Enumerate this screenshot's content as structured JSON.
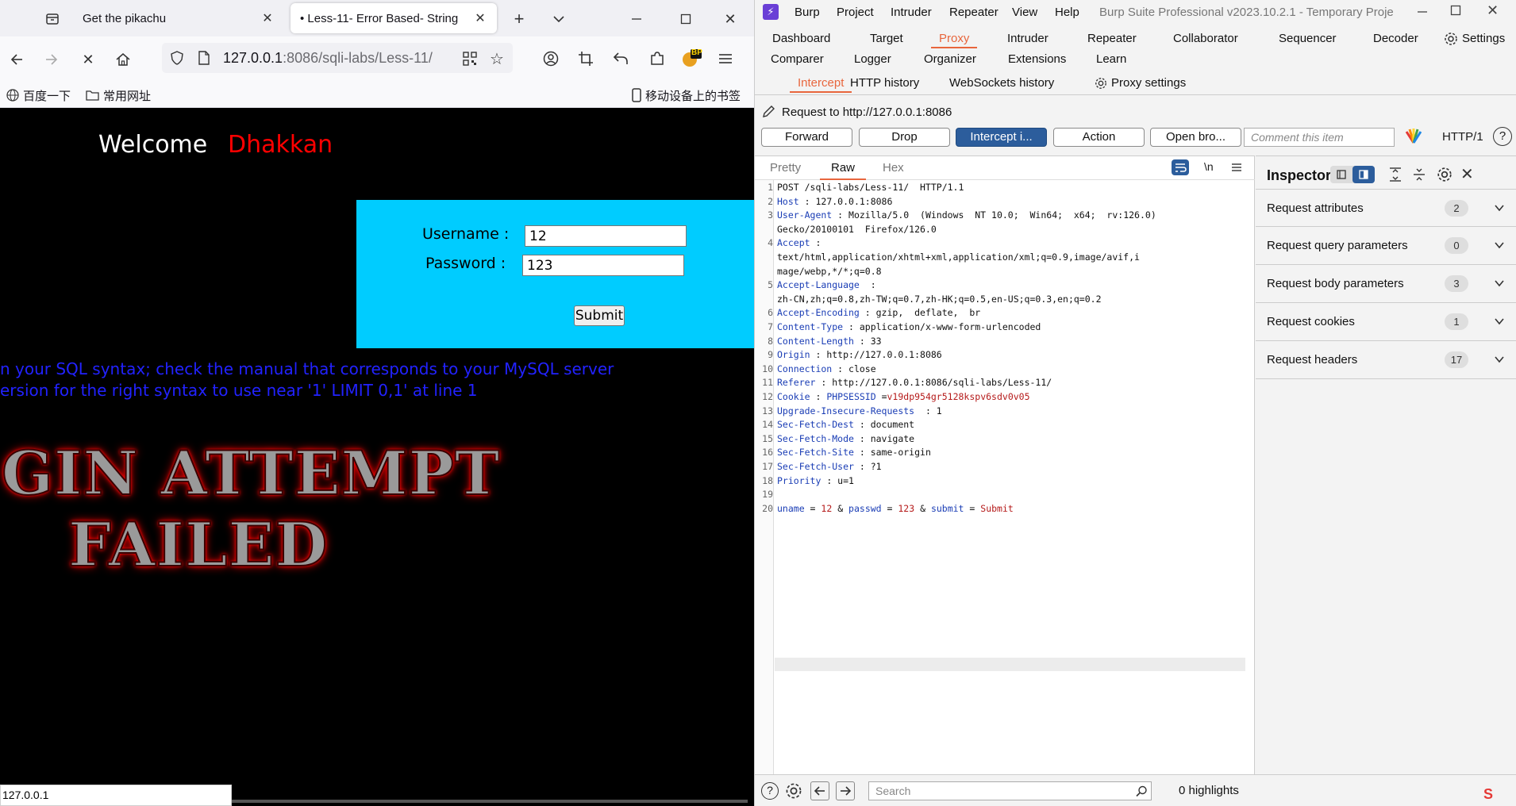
{
  "firefox": {
    "tabs": [
      {
        "title": "Get the pikachu"
      },
      {
        "title": "• Less-11- Error Based- String"
      }
    ],
    "url_host": "127.0.0.1",
    "url_rest": ":8086/sqli-labs/Less-11/",
    "bookmarks": [
      "百度一下",
      "常用网址"
    ],
    "mobile_bookmarks": "移动设备上的书签",
    "status_url": "127.0.0.1",
    "extension_badge": "BP"
  },
  "page": {
    "welcome": "Welcome",
    "name": "Dhakkan",
    "username_label": "Username :",
    "username_value": "12",
    "password_label": "Password :",
    "password_value": "123",
    "submit_label": "Submit",
    "error_line1": "n your SQL syntax; check the manual that corresponds to your MySQL server",
    "error_line2": "ersion for the right syntax to use near '1' LIMIT 0,1' at line 1",
    "fail_line1": "GIN ATTEMPT",
    "fail_line2": "FAILED"
  },
  "burp": {
    "logo": "⚡",
    "menu": [
      "Burp",
      "Project",
      "Intruder",
      "Repeater",
      "View",
      "Help"
    ],
    "window_title": "Burp Suite Professional v2023.10.2.1 - Temporary Proje",
    "tabs_row1": [
      "Dashboard",
      "Target",
      "Proxy",
      "Intruder",
      "Repeater",
      "Collaborator",
      "Sequencer",
      "Decoder"
    ],
    "tabs_row2": [
      "Comparer",
      "Logger",
      "Organizer",
      "Extensions",
      "Learn"
    ],
    "settings": "Settings",
    "proxy_tabs": [
      "Intercept",
      "HTTP history",
      "WebSockets history"
    ],
    "proxy_settings": "Proxy settings",
    "request_to": "Request to http://127.0.0.1:8086",
    "buttons": {
      "forward": "Forward",
      "drop": "Drop",
      "intercept": "Intercept i...",
      "action": "Action",
      "open_browser": "Open bro..."
    },
    "comment_placeholder": "Comment this item",
    "http_version": "HTTP/1",
    "editor_tabs": [
      "Pretty",
      "Raw",
      "Hex"
    ],
    "newline_toggle": "\\n",
    "request": [
      {
        "n": "1",
        "k": "",
        "v": "POST /sqli-labs/Less-11/  HTTP/1.1"
      },
      {
        "n": "2",
        "k": "Host",
        "v": " : 127.0.0.1:8086"
      },
      {
        "n": "3",
        "k": "User-Agent",
        "v": " : Mozilla/5.0  (Windows  NT 10.0;  Win64;  x64;  rv:126.0)"
      },
      {
        "n": "",
        "k": "",
        "v": "Gecko/20100101  Firefox/126.0"
      },
      {
        "n": "4",
        "k": "Accept",
        "v": " :"
      },
      {
        "n": "",
        "k": "",
        "v": "text/html,application/xhtml+xml,application/xml;q=0.9,image/avif,i"
      },
      {
        "n": "",
        "k": "",
        "v": "mage/webp,*/*;q=0.8"
      },
      {
        "n": "5",
        "k": "Accept-Language",
        "v": "  :"
      },
      {
        "n": "",
        "k": "",
        "v": "zh-CN,zh;q=0.8,zh-TW;q=0.7,zh-HK;q=0.5,en-US;q=0.3,en;q=0.2"
      },
      {
        "n": "6",
        "k": "Accept-Encoding",
        "v": " : gzip,  deflate,  br"
      },
      {
        "n": "7",
        "k": "Content-Type",
        "v": " : application/x-www-form-urlencoded"
      },
      {
        "n": "8",
        "k": "Content-Length",
        "v": " : 33"
      },
      {
        "n": "9",
        "k": "Origin",
        "v": " : http://127.0.0.1:8086"
      },
      {
        "n": "10",
        "k": "Connection",
        "v": " : close"
      },
      {
        "n": "11",
        "k": "Referer",
        "v": " : http://127.0.0.1:8086/sqli-labs/Less-11/"
      },
      {
        "n": "12",
        "k": "Cookie",
        "v": " : ",
        "k2": "PHPSESSID",
        "v2": " =",
        "cv": "v19dp954gr5128kspv6sdv0v05"
      },
      {
        "n": "13",
        "k": "Upgrade-Insecure-Requests",
        "v": "  : 1"
      },
      {
        "n": "14",
        "k": "Sec-Fetch-Dest",
        "v": " : document"
      },
      {
        "n": "15",
        "k": "Sec-Fetch-Mode",
        "v": " : navigate"
      },
      {
        "n": "16",
        "k": "Sec-Fetch-Site",
        "v": " : same-origin"
      },
      {
        "n": "17",
        "k": "Sec-Fetch-User",
        "v": " : ?1"
      },
      {
        "n": "18",
        "k": "Priority",
        "v": " : u=1"
      },
      {
        "n": "19",
        "k": "",
        "v": ""
      }
    ],
    "body_line_number": "20",
    "body_params": [
      {
        "k": "uname",
        "v": "12"
      },
      {
        "k": "passwd",
        "v": "123"
      },
      {
        "k": "submit",
        "v": "Submit"
      }
    ],
    "inspector": {
      "title": "Inspector",
      "rows": [
        {
          "label": "Request attributes",
          "count": "2"
        },
        {
          "label": "Request query parameters",
          "count": "0"
        },
        {
          "label": "Request body parameters",
          "count": "3"
        },
        {
          "label": "Request cookies",
          "count": "1"
        },
        {
          "label": "Request headers",
          "count": "17"
        }
      ]
    },
    "search_placeholder": "Search",
    "highlights": "0 highlights"
  },
  "colors": {
    "burp_accent": "#e8663d",
    "primary_button": "#2c5d9c",
    "login_box": "#00ccff",
    "error_text": "#2222ff",
    "name_text": "#ff0000"
  }
}
